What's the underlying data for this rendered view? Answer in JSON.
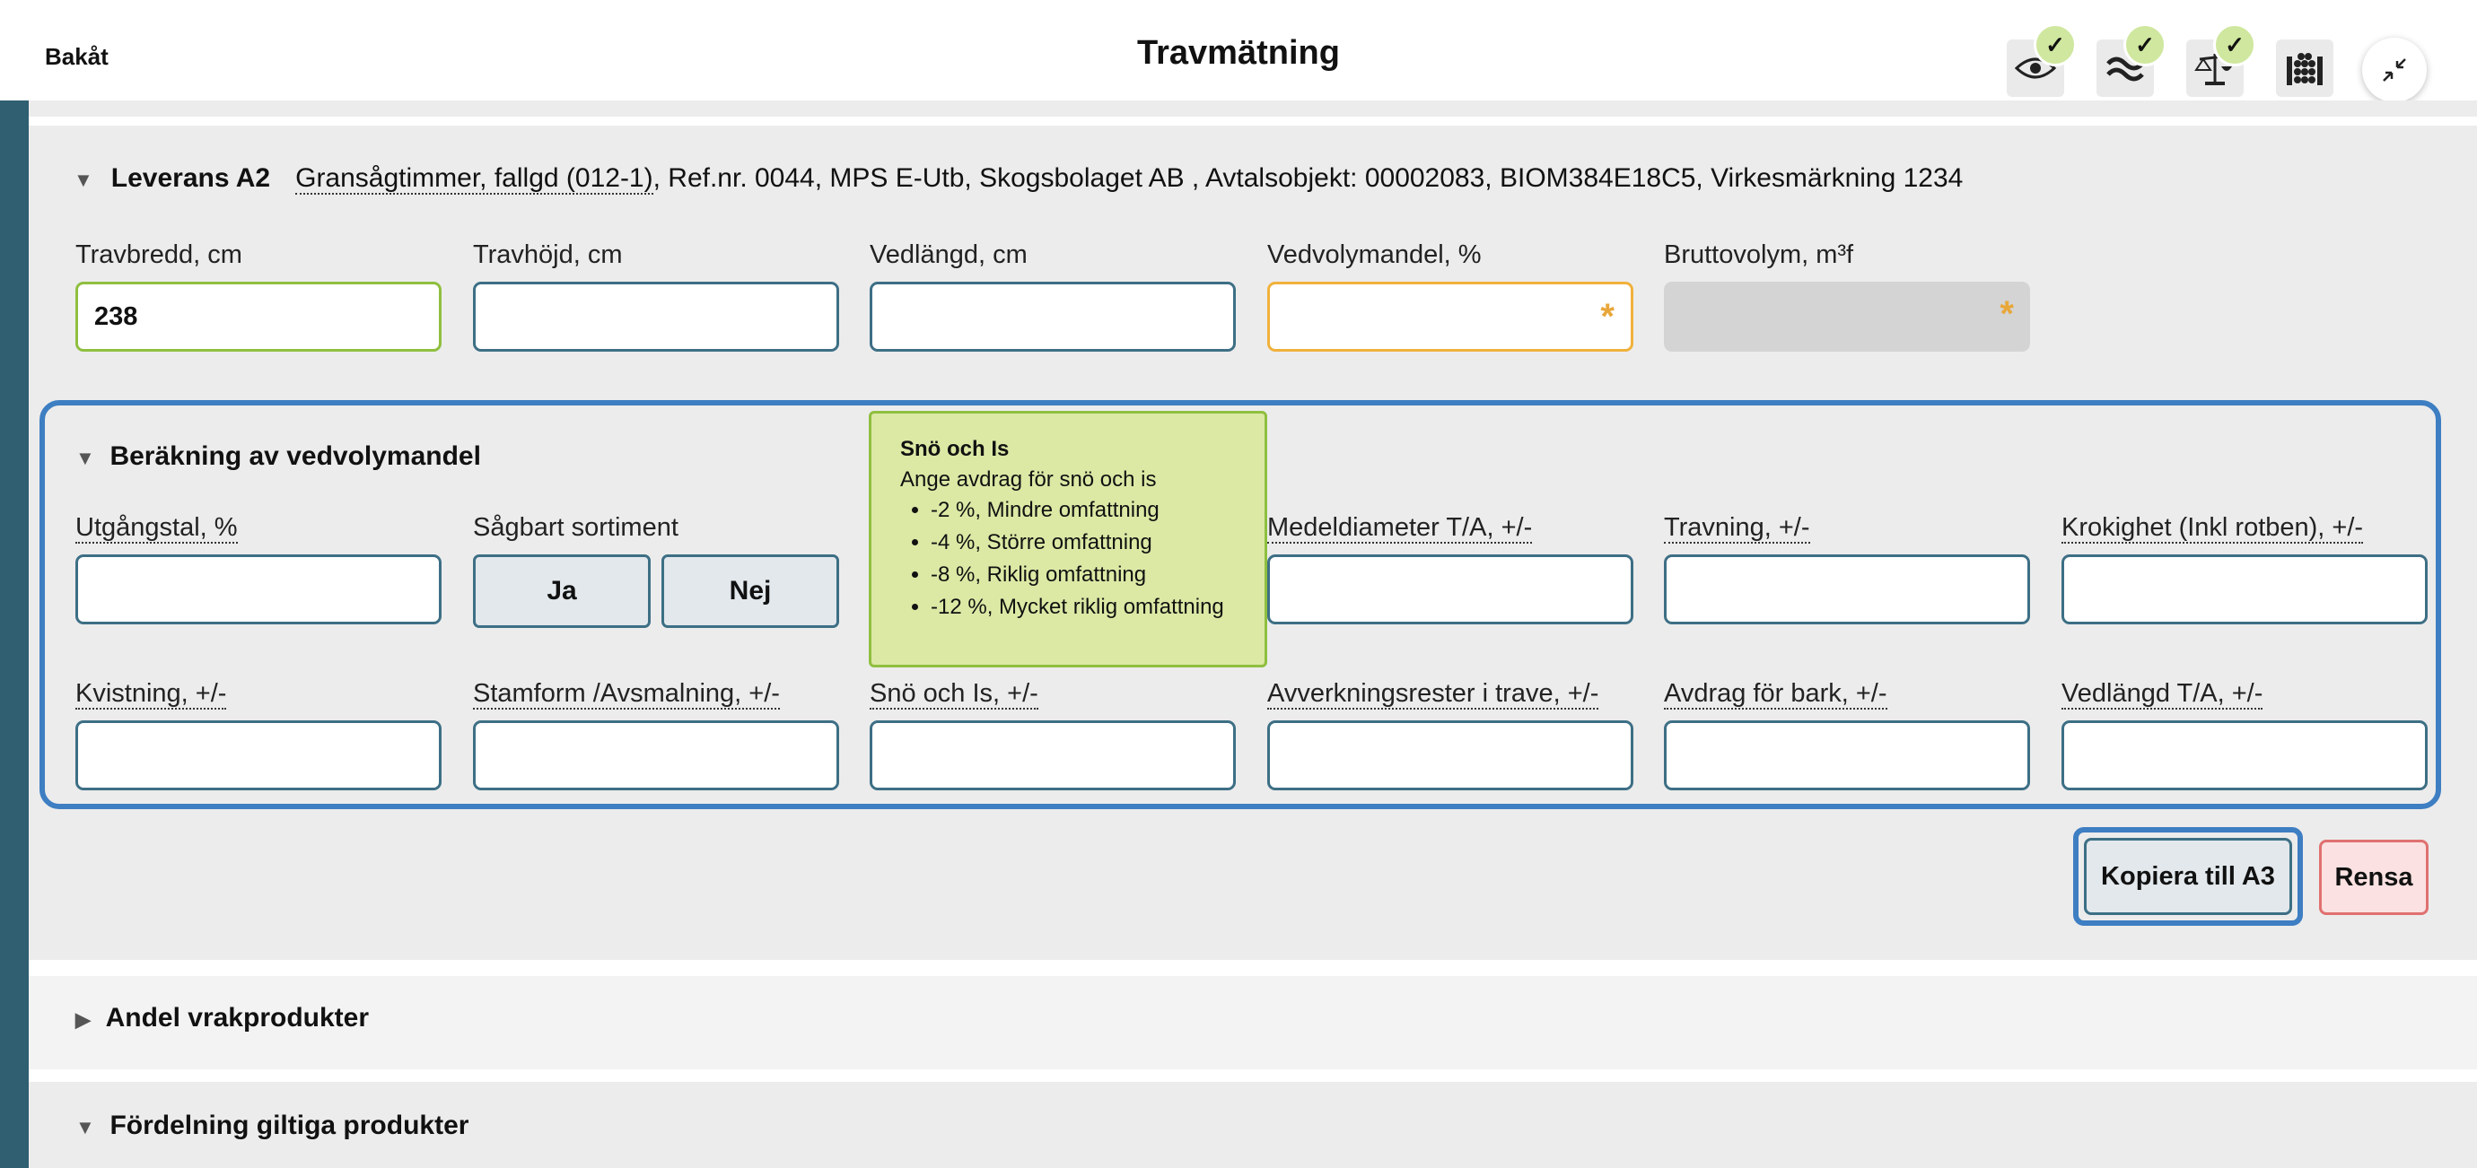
{
  "header": {
    "back_label": "Bakåt",
    "title": "Travmätning",
    "status_icons": [
      {
        "icon": "eye-icon",
        "checked": true
      },
      {
        "icon": "approx-icon",
        "checked": true
      },
      {
        "icon": "scale-icon",
        "checked": true
      },
      {
        "icon": "stack-icon",
        "checked": false
      }
    ],
    "check_glyph": "✓"
  },
  "delivery": {
    "label": "Leverans A2",
    "product": "Gransågtimmer, fallgd (012-1)",
    "details": ", Ref.nr. 0044, MPS E-Utb, Skogsbolaget AB , Avtalsobjekt: 00002083, BIOM384E18C5, Virkesmärkning 1234"
  },
  "fields": {
    "travbredd": {
      "label": "Travbredd, cm",
      "value": "238"
    },
    "travhojd": {
      "label": "Travhöjd, cm",
      "value": ""
    },
    "vedlangd": {
      "label": "Vedlängd, cm",
      "value": ""
    },
    "vedvolymandel": {
      "label": "Vedvolymandel, %",
      "value": "",
      "required_mark": "*"
    },
    "bruttovolym": {
      "label": "Bruttovolym, m³f",
      "value": "",
      "required_mark": "*"
    }
  },
  "calc": {
    "title": "Beräkning av vedvolymandel",
    "utgangstal": "Utgångstal, %",
    "sagbart": "Sågbart sortiment",
    "ja": "Ja",
    "nej": "Nej",
    "medeldiameter": "Medeldiameter T/A, +/-",
    "travning": "Travning, +/-",
    "krokighet": "Krokighet (Inkl rotben), +/-",
    "kvistning": "Kvistning, +/-",
    "stamform": "Stamform /Avsmalning, +/-",
    "sno": "Snö och Is, +/-",
    "avverkningsrester": "Avverkningsrester i trave, +/-",
    "bark": "Avdrag för bark, +/-",
    "vedlangd_ta": "Vedlängd T/A, +/-"
  },
  "tooltip": {
    "title": "Snö och Is",
    "subtitle": "Ange avdrag för snö och is",
    "items": [
      "-2 %, Mindre omfattning",
      "-4 %, Större omfattning",
      "-8 %, Riklig omfattning",
      "-12 %, Mycket riklig omfattning"
    ]
  },
  "actions": {
    "copy": "Kopiera till A3",
    "clear": "Rensa"
  },
  "sections": {
    "vrak": "Andel vrakprodukter",
    "fordelning": "Fördelning giltiga produkter"
  },
  "colors": {
    "rail": "#2f5f70",
    "focus": "#3e7ec2",
    "tooltip_bg": "#dbe9a5",
    "check_bg": "#cfe79e"
  }
}
